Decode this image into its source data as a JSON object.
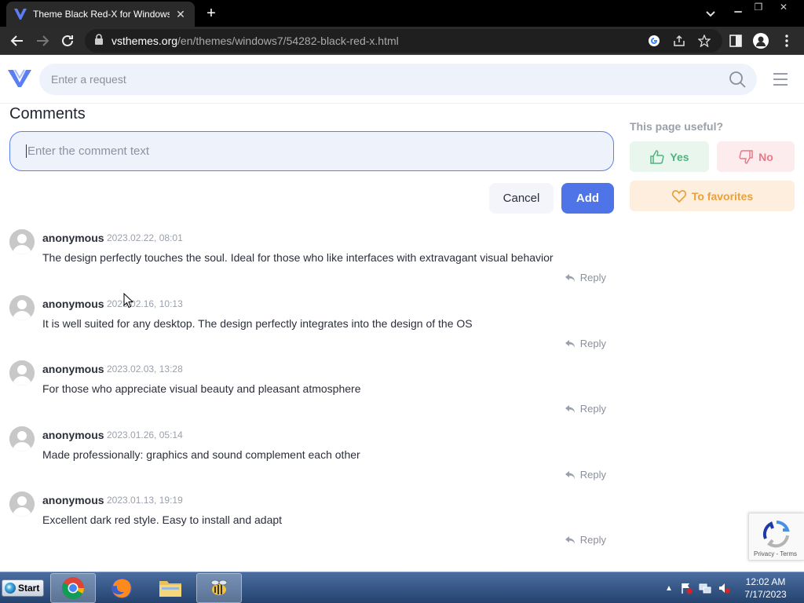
{
  "browser": {
    "tab_title": "Theme Black Red-X for Windows",
    "url_domain": "vsthemes.org",
    "url_path": "/en/themes/windows7/54282-black-red-x.html"
  },
  "site": {
    "search_placeholder": "Enter a request"
  },
  "comments": {
    "title": "Comments",
    "input_placeholder": "Enter the comment text",
    "cancel_label": "Cancel",
    "add_label": "Add",
    "reply_label": "Reply",
    "items": [
      {
        "author": "anonymous",
        "date": "2023.02.22, 08:01",
        "text": "The design perfectly touches the soul. Ideal for those who like interfaces with extravagant visual behavior"
      },
      {
        "author": "anonymous",
        "date": "2023.02.16, 10:13",
        "text": "It is well suited for any desktop. The design perfectly integrates into the design of the OS"
      },
      {
        "author": "anonymous",
        "date": "2023.02.03, 13:28",
        "text": "For those who appreciate visual beauty and pleasant atmosphere"
      },
      {
        "author": "anonymous",
        "date": "2023.01.26, 05:14",
        "text": "Made professionally: graphics and sound complement each other"
      },
      {
        "author": "anonymous",
        "date": "2023.01.13, 19:19",
        "text": "Excellent dark red style. Easy to install and adapt"
      }
    ]
  },
  "sidebar": {
    "useful_label": "This page useful?",
    "yes_label": "Yes",
    "no_label": "No",
    "favorites_label": "To favorites"
  },
  "recaptcha": {
    "privacy": "Privacy",
    "separator": " - ",
    "terms": "Terms"
  },
  "taskbar": {
    "start_label": "Start",
    "time": "12:02 AM",
    "date": "7/17/2023"
  },
  "colors": {
    "accent": "#4f74e8",
    "yes": "#4fb37f",
    "no": "#e57b8a",
    "favorites": "#e8a13d"
  }
}
